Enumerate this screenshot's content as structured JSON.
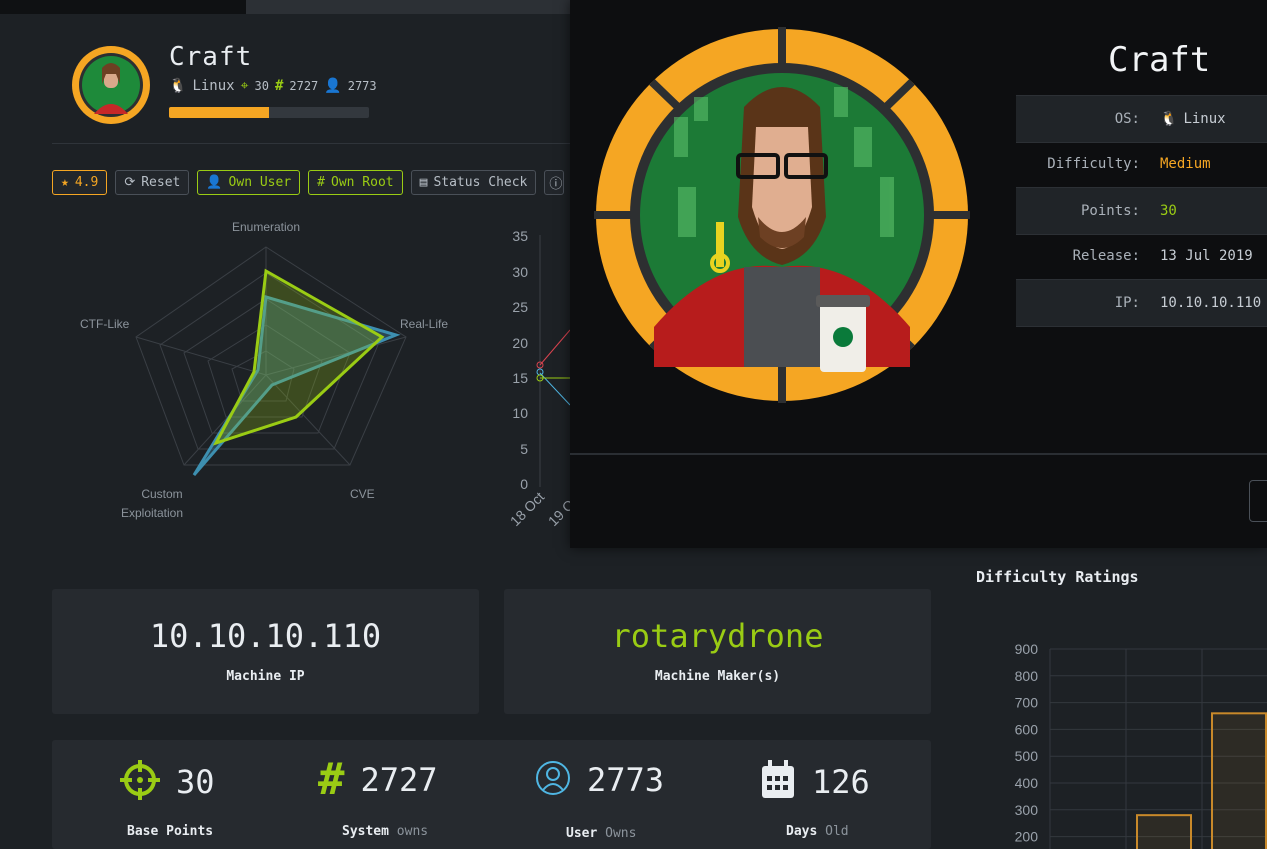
{
  "machine": {
    "name": "Craft",
    "os": "Linux",
    "points": "30",
    "system_owns": "2727",
    "user_owns": "2773",
    "progress_fraction": 0.5
  },
  "actions": {
    "rating": "4.9",
    "reset": "Reset",
    "own_user": "Own User",
    "own_root": "Own Root",
    "status_check": "Status Check"
  },
  "overlay": {
    "title": "Craft",
    "rows": [
      {
        "key": "OS:",
        "value": "Linux"
      },
      {
        "key": "Difficulty:",
        "value": "Medium"
      },
      {
        "key": "Points:",
        "value": "30"
      },
      {
        "key": "Release:",
        "value": "13 Jul 2019"
      },
      {
        "key": "IP:",
        "value": "10.10.10.110"
      }
    ]
  },
  "radar": {
    "axes": [
      "Enumeration",
      "Real-Life",
      "CVE",
      "Custom",
      "Exploitation",
      "CTF-Like"
    ]
  },
  "timeline_chart": {
    "y_ticks": [
      "35",
      "30",
      "25",
      "20",
      "15",
      "10",
      "5",
      "0"
    ],
    "x_ticks": [
      "18 Oct",
      "19 O"
    ]
  },
  "cards": {
    "machine_ip": "10.10.10.110",
    "machine_ip_label": "Machine IP",
    "maker": "rotarydrone",
    "maker_label": "Machine Maker(s)"
  },
  "stats": {
    "base_points": "30",
    "base_points_label": "Base Points",
    "system": "2727",
    "system_label": "System",
    "system_suffix": "owns",
    "user": "2773",
    "user_label": "User",
    "user_suffix": "Owns",
    "days": "126",
    "days_label": "Days",
    "days_suffix": "Old"
  },
  "difficulty": {
    "title": "Difficulty Ratings",
    "y_ticks": [
      "900",
      "800",
      "700",
      "600",
      "500",
      "400",
      "300",
      "200"
    ]
  },
  "colors": {
    "orange": "#f5a623",
    "green": "#9acc14",
    "blue": "#4fb6e3",
    "bg": "#1d2125"
  },
  "chart_data": {
    "type": "bar",
    "title": "Difficulty Ratings",
    "ylim": [
      200,
      900
    ],
    "values": [
      280,
      660
    ]
  }
}
